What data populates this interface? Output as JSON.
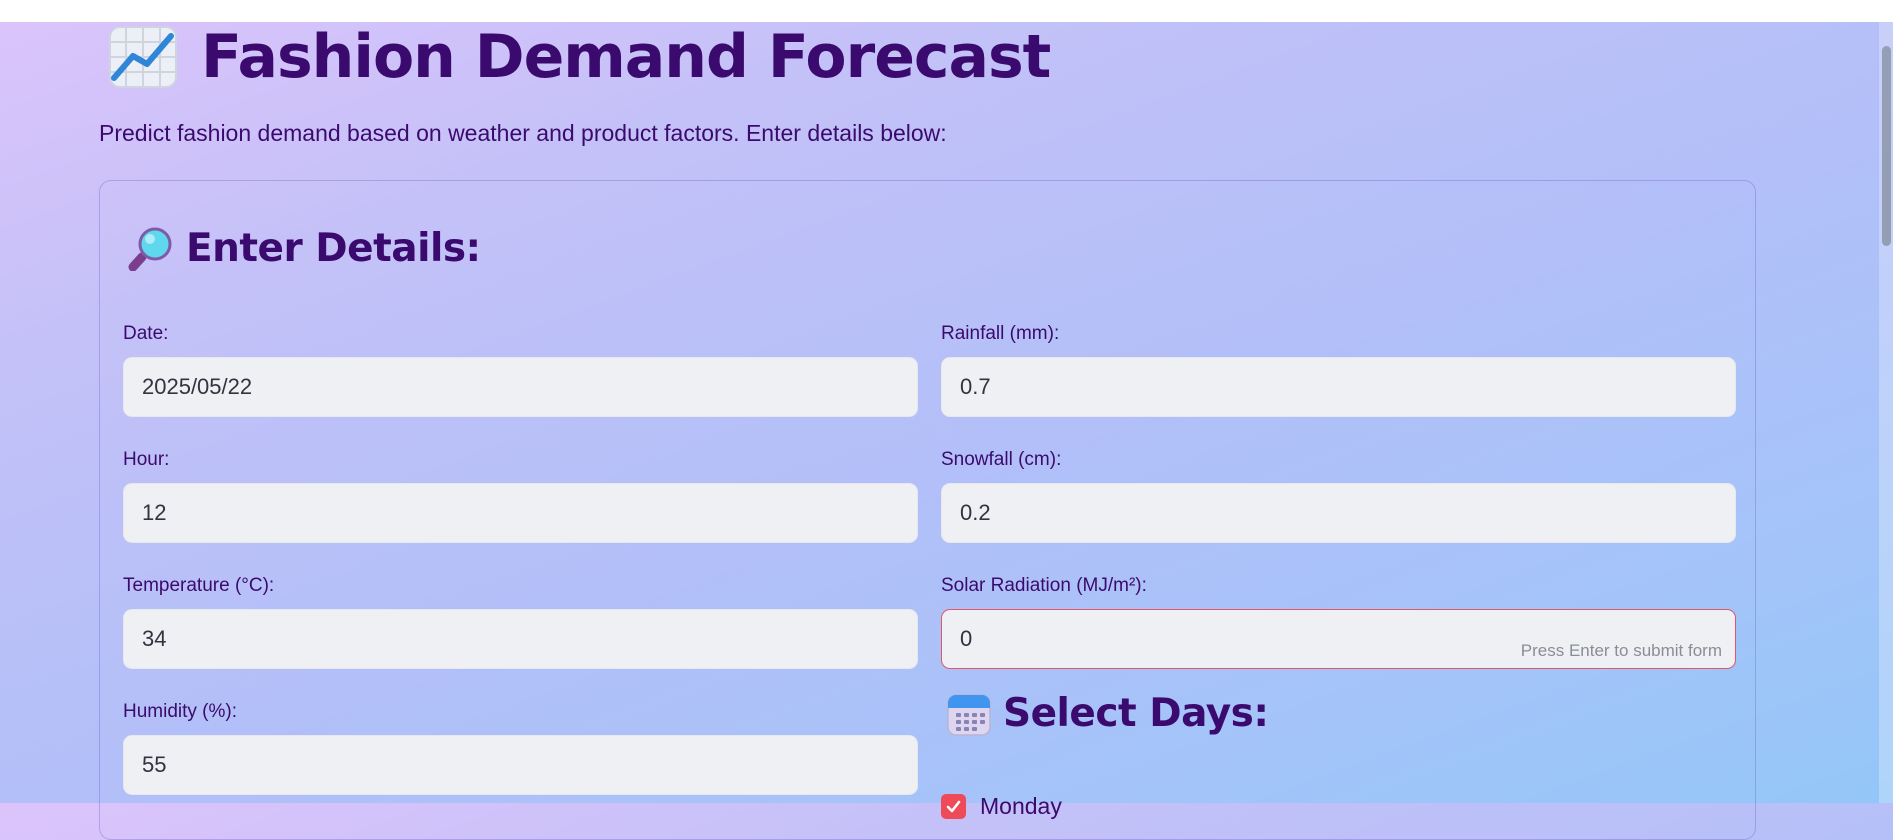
{
  "header": {
    "title": "Fashion Demand Forecast",
    "title_icon": "chart-increasing-icon",
    "subtitle": "Predict fashion demand based on weather and product factors. Enter details below:"
  },
  "form": {
    "section_title": "Enter Details:",
    "section_icon": "magnifying-glass-icon",
    "fields": {
      "date": {
        "label": "Date:",
        "value": "2025/05/22"
      },
      "hour": {
        "label": "Hour:",
        "value": "12"
      },
      "temperature": {
        "label": "Temperature (°C):",
        "value": "34"
      },
      "humidity": {
        "label": "Humidity (%):",
        "value": "55"
      },
      "rainfall": {
        "label": "Rainfall (mm):",
        "value": "0.7"
      },
      "snowfall": {
        "label": "Snowfall (cm):",
        "value": "0.2"
      },
      "solar": {
        "label": "Solar Radiation (MJ/m²):",
        "value": "0",
        "hint": "Press Enter to submit form"
      }
    },
    "days": {
      "section_title": "Select Days:",
      "section_icon": "calendar-icon",
      "items": [
        {
          "label": "Monday",
          "checked": true
        }
      ]
    }
  },
  "colors": {
    "title": "#3b0a6e",
    "checkbox": "#ee4a59",
    "error_border": "#e0576a",
    "input_bg": "#eff0f4"
  }
}
